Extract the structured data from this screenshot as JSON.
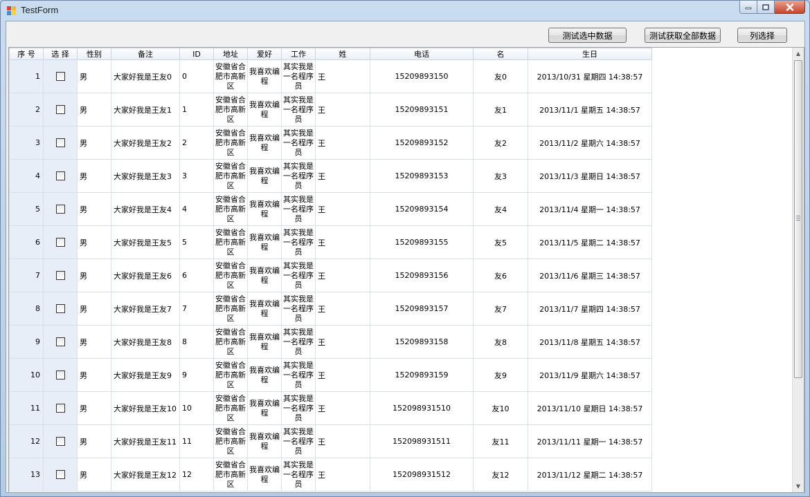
{
  "window": {
    "title": "TestForm"
  },
  "toolbar": {
    "test_selected_label": "测试选中数据",
    "test_all_label": "测试获取全部数据",
    "column_select_label": "列选择"
  },
  "grid": {
    "headers": [
      "序 号",
      "选 择",
      "性别",
      "备注",
      "ID",
      "地址",
      "爱好",
      "工作",
      "姓",
      "电话",
      "名",
      "生日"
    ],
    "rows": [
      {
        "no": "1",
        "gender": "男",
        "remark": "大家好我是王友0",
        "id": "0",
        "address": "安徽省合肥市高新区",
        "hobby": "我喜欢编程",
        "job": "其实我是一名程序员",
        "surname": "王",
        "phone": "15209893150",
        "given_name": "友0",
        "birthday": "2013/10/31 星期四 14:38:57"
      },
      {
        "no": "2",
        "gender": "男",
        "remark": "大家好我是王友1",
        "id": "1",
        "address": "安徽省合肥市高新区",
        "hobby": "我喜欢编程",
        "job": "其实我是一名程序员",
        "surname": "王",
        "phone": "15209893151",
        "given_name": "友1",
        "birthday": "2013/11/1 星期五 14:38:57"
      },
      {
        "no": "3",
        "gender": "男",
        "remark": "大家好我是王友2",
        "id": "2",
        "address": "安徽省合肥市高新区",
        "hobby": "我喜欢编程",
        "job": "其实我是一名程序员",
        "surname": "王",
        "phone": "15209893152",
        "given_name": "友2",
        "birthday": "2013/11/2 星期六 14:38:57"
      },
      {
        "no": "4",
        "gender": "男",
        "remark": "大家好我是王友3",
        "id": "3",
        "address": "安徽省合肥市高新区",
        "hobby": "我喜欢编程",
        "job": "其实我是一名程序员",
        "surname": "王",
        "phone": "15209893153",
        "given_name": "友3",
        "birthday": "2013/11/3 星期日 14:38:57"
      },
      {
        "no": "5",
        "gender": "男",
        "remark": "大家好我是王友4",
        "id": "4",
        "address": "安徽省合肥市高新区",
        "hobby": "我喜欢编程",
        "job": "其实我是一名程序员",
        "surname": "王",
        "phone": "15209893154",
        "given_name": "友4",
        "birthday": "2013/11/4 星期一 14:38:57"
      },
      {
        "no": "6",
        "gender": "男",
        "remark": "大家好我是王友5",
        "id": "5",
        "address": "安徽省合肥市高新区",
        "hobby": "我喜欢编程",
        "job": "其实我是一名程序员",
        "surname": "王",
        "phone": "15209893155",
        "given_name": "友5",
        "birthday": "2013/11/5 星期二 14:38:57"
      },
      {
        "no": "7",
        "gender": "男",
        "remark": "大家好我是王友6",
        "id": "6",
        "address": "安徽省合肥市高新区",
        "hobby": "我喜欢编程",
        "job": "其实我是一名程序员",
        "surname": "王",
        "phone": "15209893156",
        "given_name": "友6",
        "birthday": "2013/11/6 星期三 14:38:57"
      },
      {
        "no": "8",
        "gender": "男",
        "remark": "大家好我是王友7",
        "id": "7",
        "address": "安徽省合肥市高新区",
        "hobby": "我喜欢编程",
        "job": "其实我是一名程序员",
        "surname": "王",
        "phone": "15209893157",
        "given_name": "友7",
        "birthday": "2013/11/7 星期四 14:38:57"
      },
      {
        "no": "9",
        "gender": "男",
        "remark": "大家好我是王友8",
        "id": "8",
        "address": "安徽省合肥市高新区",
        "hobby": "我喜欢编程",
        "job": "其实我是一名程序员",
        "surname": "王",
        "phone": "15209893158",
        "given_name": "友8",
        "birthday": "2013/11/8 星期五 14:38:57"
      },
      {
        "no": "10",
        "gender": "男",
        "remark": "大家好我是王友9",
        "id": "9",
        "address": "安徽省合肥市高新区",
        "hobby": "我喜欢编程",
        "job": "其实我是一名程序员",
        "surname": "王",
        "phone": "15209893159",
        "given_name": "友9",
        "birthday": "2013/11/9 星期六 14:38:57"
      },
      {
        "no": "11",
        "gender": "男",
        "remark": "大家好我是王友10",
        "id": "10",
        "address": "安徽省合肥市高新区",
        "hobby": "我喜欢编程",
        "job": "其实我是一名程序员",
        "surname": "王",
        "phone": "152098931510",
        "given_name": "友10",
        "birthday": "2013/11/10 星期日 14:38:57"
      },
      {
        "no": "12",
        "gender": "男",
        "remark": "大家好我是王友11",
        "id": "11",
        "address": "安徽省合肥市高新区",
        "hobby": "我喜欢编程",
        "job": "其实我是一名程序员",
        "surname": "王",
        "phone": "152098931511",
        "given_name": "友11",
        "birthday": "2013/11/11 星期一 14:38:57"
      },
      {
        "no": "13",
        "gender": "男",
        "remark": "大家好我是王友12",
        "id": "12",
        "address": "安徽省合肥市高新区",
        "hobby": "我喜欢编程",
        "job": "其实我是一名程序员",
        "surname": "王",
        "phone": "152098931512",
        "given_name": "友12",
        "birthday": "2013/11/12 星期二 14:38:57"
      }
    ]
  }
}
